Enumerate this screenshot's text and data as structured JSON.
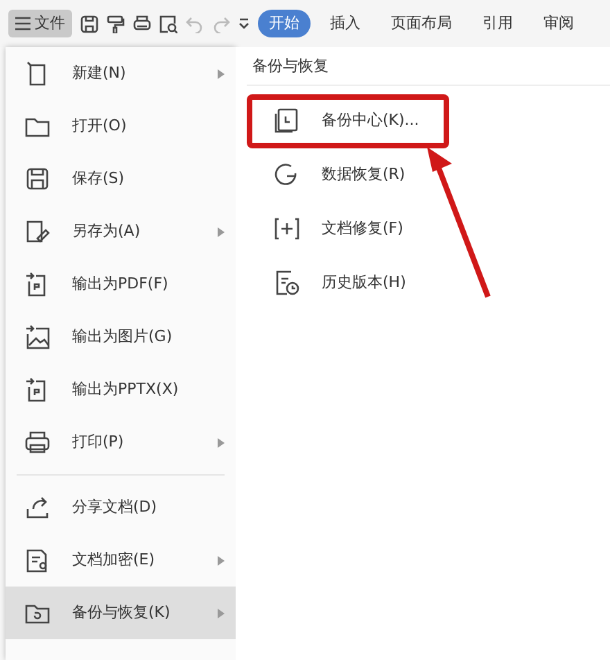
{
  "toolbar": {
    "file_button": "文件",
    "undo_disabled": true,
    "redo_disabled": true,
    "tabs": [
      {
        "label": "开始",
        "selected": true
      },
      {
        "label": "插入",
        "selected": false
      },
      {
        "label": "页面布局",
        "selected": false
      },
      {
        "label": "引用",
        "selected": false
      },
      {
        "label": "审阅",
        "selected": false
      }
    ]
  },
  "file_menu": {
    "items": [
      {
        "label": "新建(N)",
        "submenu": true,
        "selected": false,
        "divider_before": false
      },
      {
        "label": "打开(O)",
        "submenu": false,
        "selected": false,
        "divider_before": false
      },
      {
        "label": "保存(S)",
        "submenu": false,
        "selected": false,
        "divider_before": false
      },
      {
        "label": "另存为(A)",
        "submenu": true,
        "selected": false,
        "divider_before": false
      },
      {
        "label": "输出为PDF(F)",
        "submenu": false,
        "selected": false,
        "divider_before": false
      },
      {
        "label": "输出为图片(G)",
        "submenu": false,
        "selected": false,
        "divider_before": false
      },
      {
        "label": "输出为PPTX(X)",
        "submenu": false,
        "selected": false,
        "divider_before": false
      },
      {
        "label": "打印(P)",
        "submenu": true,
        "selected": false,
        "divider_before": false
      },
      {
        "label": "分享文档(D)",
        "submenu": false,
        "selected": false,
        "divider_before": true
      },
      {
        "label": "文档加密(E)",
        "submenu": true,
        "selected": false,
        "divider_before": false
      },
      {
        "label": "备份与恢复(K)",
        "submenu": true,
        "selected": true,
        "divider_before": false
      }
    ]
  },
  "submenu": {
    "title": "备份与恢复",
    "items": [
      {
        "label": "备份中心(K)...",
        "highlighted": true
      },
      {
        "label": "数据恢复(R)",
        "highlighted": false
      },
      {
        "label": "文档修复(F)",
        "highlighted": false
      },
      {
        "label": "历史版本(H)",
        "highlighted": false
      }
    ]
  }
}
